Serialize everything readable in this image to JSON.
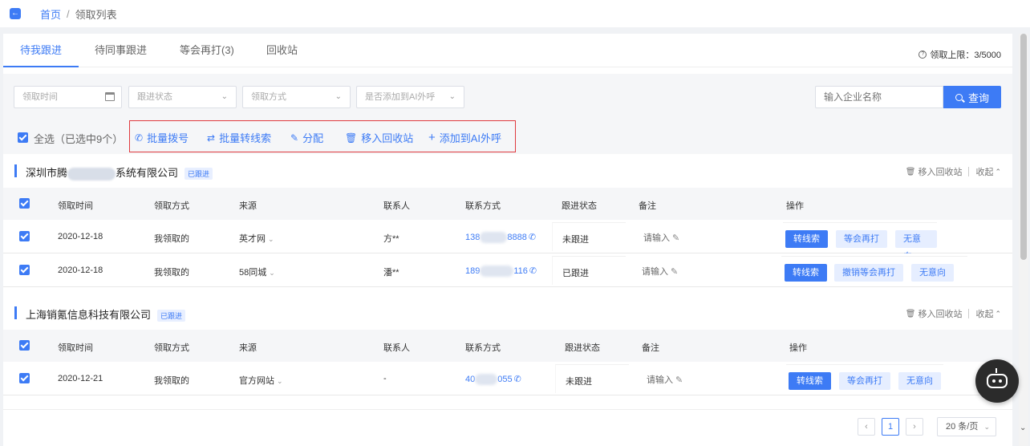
{
  "breadcrumb": {
    "home": "首页",
    "separator": "/",
    "current": "领取列表"
  },
  "tabs": [
    {
      "label": "待我跟进",
      "active": true
    },
    {
      "label": "待同事跟进",
      "active": false
    },
    {
      "label": "等会再打(3)",
      "active": false
    },
    {
      "label": "回收站",
      "active": false
    }
  ],
  "quota": {
    "icon": "question-circle-icon",
    "text": "领取上限：3/5000"
  },
  "filters": {
    "receive_time": "领取时间",
    "follow_status": "跟进状态",
    "receive_method": "领取方式",
    "ai_call": "是否添加到AI外呼",
    "search_placeholder": "输入企业名称",
    "search_button": "查询"
  },
  "batch": {
    "select_all": "全选（已选中9个）",
    "actions": [
      {
        "label": "批量拨号",
        "icon": "phone-icon"
      },
      {
        "label": "批量转线索",
        "icon": "swap-icon"
      },
      {
        "label": "分配",
        "icon": "assign-icon"
      },
      {
        "label": "移入回收站",
        "icon": "trash-icon"
      },
      {
        "label": "添加到AI外呼",
        "icon": "plus-icon"
      }
    ]
  },
  "columns": [
    "领取时间",
    "领取方式",
    "来源",
    "联系人",
    "联系方式",
    "跟进状态",
    "备注",
    "操作"
  ],
  "group_actions": {
    "recycle": "移入回收站",
    "collapse": "收起"
  },
  "groups": [
    {
      "name_start": "深圳市腾",
      "name_end": "系统有限公司",
      "badge": "已跟进",
      "rows": [
        {
          "time": "2020-12-18",
          "method": "我领取的",
          "source": "英才网",
          "contact": "方**",
          "phone_start": "138",
          "phone_end": "8888",
          "status": "未跟进",
          "note": "请输入",
          "actions": [
            "转线索",
            "等会再打",
            "无意向"
          ]
        },
        {
          "time": "2020-12-18",
          "method": "我领取的",
          "source": "58同城",
          "contact": "潘**",
          "phone_start": "189",
          "phone_end": "116",
          "status": "已跟进",
          "note": "请输入",
          "actions": [
            "转线索",
            "撤销等会再打",
            "无意向"
          ]
        }
      ]
    },
    {
      "name": "上海销氪信息科技有限公司",
      "badge": "已跟进",
      "rows": [
        {
          "time": "2020-12-21",
          "method": "我领取的",
          "source": "官方网站",
          "contact": "-",
          "phone_start": "40",
          "phone_end": "055",
          "status": "未跟进",
          "note": "请输入",
          "actions": [
            "转线索",
            "等会再打",
            "无意向"
          ]
        }
      ]
    }
  ],
  "pagination": {
    "current": "1",
    "page_size": "20 条/页"
  },
  "colors": {
    "primary": "#3d7bf5",
    "highlight_border": "#e0393e"
  }
}
